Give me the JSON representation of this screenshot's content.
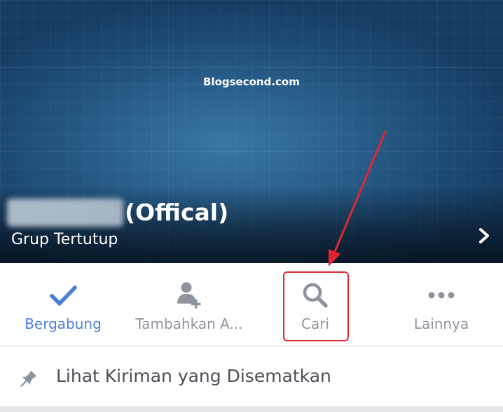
{
  "cover": {
    "watermark": "Blogsecond.com",
    "group_title": "(Offical)",
    "group_type": "Grup Tertutup"
  },
  "actions": [
    {
      "label": "Bergabung",
      "icon": "check-icon",
      "active": true
    },
    {
      "label": "Tambahkan A...",
      "icon": "add-person-icon",
      "active": false
    },
    {
      "label": "Cari",
      "icon": "search-icon",
      "active": false
    },
    {
      "label": "Lainnya",
      "icon": "more-dots-icon",
      "active": false
    }
  ],
  "pinned": {
    "label": "Lihat Kiriman yang Disematkan",
    "icon": "pin-icon"
  },
  "colors": {
    "accent": "#4b7fd6",
    "muted": "#90949c",
    "annotation": "#e0262e"
  }
}
